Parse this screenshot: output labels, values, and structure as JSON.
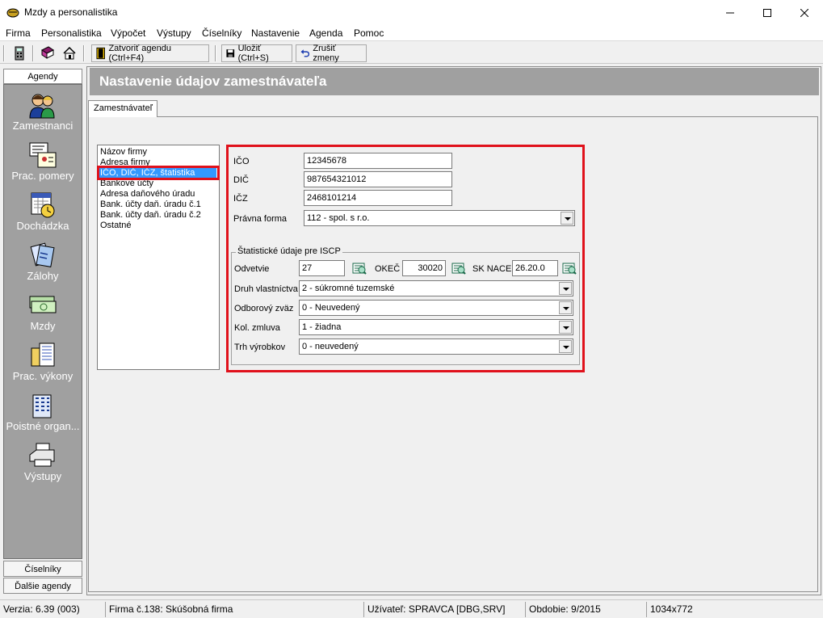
{
  "window": {
    "title": "Mzdy a personalistika"
  },
  "menu": [
    "Firma",
    "Personalistika",
    "Výpočet",
    "Výstupy",
    "Číselníky",
    "Nastavenie",
    "Agenda",
    "Pomoc"
  ],
  "toolbar": {
    "close_agenda": "Zatvoriť agendu (Ctrl+F4)",
    "save": "Uložiť (Ctrl+S)",
    "cancel": "Zrušiť zmeny"
  },
  "agenda": {
    "header": "Agendy",
    "items": [
      "Zamestnanci",
      "Prac. pomery",
      "Dochádzka",
      "Zálohy",
      "Mzdy",
      "Prac. výkony",
      "Poistné organ...",
      "Výstupy"
    ],
    "footer": [
      "Číselníky",
      "Ďalšie agendy"
    ]
  },
  "page": {
    "title": "Nastavenie údajov zamestnávateľa",
    "tab": "Zamestnávateľ"
  },
  "sections": [
    "Názov firmy",
    "Adresa firmy",
    "IČO, DIČ, IČZ, štatistika",
    "Bankové účty",
    "Adresa daňového úradu",
    "Bank. účty daň. úradu č.1",
    "Bank. účty daň. úradu č.2",
    "Ostatné"
  ],
  "form": {
    "ico_label": "IČO",
    "ico": "12345678",
    "dic_label": "DIČ",
    "dic": "987654321012",
    "icz_label": "IČZ",
    "icz": "2468101214",
    "pravna_forma_label": "Právna forma",
    "pravna_forma": "112 - spol. s r.o.",
    "stat_title": "Štatistické údaje pre ISCP",
    "odvetvie_label": "Odvetvie",
    "odvetvie": "27",
    "okec_label": "OKEČ",
    "okec": "30020",
    "sknace_label": "SK NACE",
    "sknace": "26.20.0",
    "druh_label": "Druh vlastníctva",
    "druh": "2 - súkromné tuzemské",
    "odbor_label": "Odborový zväz",
    "odbor": "0 - Neuvedený",
    "kol_label": "Kol. zmluva",
    "kol": "1 - žiadna",
    "trh_label": "Trh výrobkov",
    "trh": "0 - neuvedený"
  },
  "status": {
    "version": "Verzia: 6.39 (003)",
    "firm": "Firma č.138: Skúšobná firma",
    "user": "Užívateľ: SPRAVCA [DBG,SRV]",
    "period": "Obdobie: 9/2015",
    "resolution": "1034x772"
  }
}
